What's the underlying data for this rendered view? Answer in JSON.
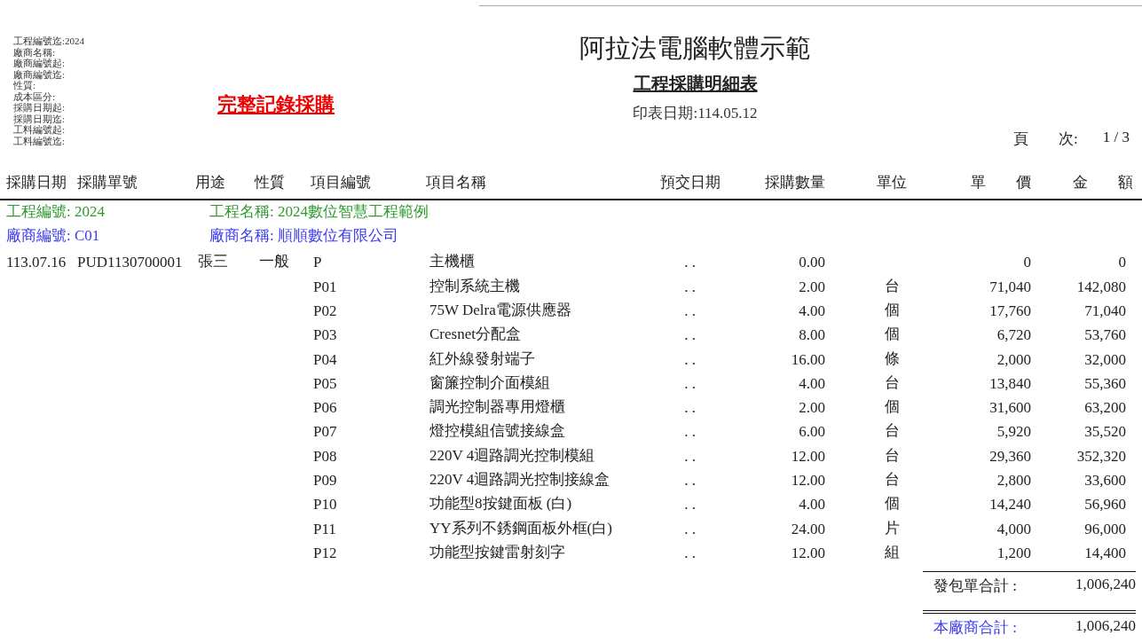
{
  "report": {
    "title": "阿拉法電腦軟體示範",
    "subtitle": "工程採購明細表",
    "print_date": "印表日期:114.05.12",
    "note": "完整記錄採購",
    "page_label": "頁　　次:",
    "page": "1 / 3"
  },
  "filters": [
    "工程編號迄:2024",
    "廠商名稱:",
    "廠商編號起:",
    "廠商編號迄:",
    "性質:",
    "成本區分:",
    "採購日期起:",
    "採購日期迄:",
    "工料編號起:",
    "工料編號迄:"
  ],
  "columns": [
    "採購日期",
    "採購單號",
    "用途",
    "性質",
    "項目編號",
    "項目名稱",
    "預交日期",
    "採購數量",
    "單位",
    "單　　價",
    "金　　額"
  ],
  "project": {
    "code": "工程編號: 2024",
    "name": "工程名稱: 2024數位智慧工程範例"
  },
  "vendor": {
    "code": "廠商編號: C01",
    "name": "廠商名稱: 順順數位有限公司"
  },
  "order": {
    "date": "113.07.16",
    "number": "PUD1130700001",
    "purpose": "張三",
    "nature": "一般"
  },
  "items": [
    {
      "code": "P",
      "name": "主機櫃",
      "delivery": ". .",
      "qty": "0.00",
      "price": "0",
      "amount": "0"
    },
    {
      "code": "P01",
      "name": "控制系統主機",
      "delivery": ". .",
      "qty": "2.00",
      "unit": "台",
      "price": "71,040",
      "amount": "142,080"
    },
    {
      "code": "P02",
      "name": "75W Delra電源供應器",
      "delivery": ". .",
      "qty": "4.00",
      "unit": "個",
      "price": "17,760",
      "amount": "71,040"
    },
    {
      "code": "P03",
      "name": "Cresnet分配盒",
      "delivery": ". .",
      "qty": "8.00",
      "unit": "個",
      "price": "6,720",
      "amount": "53,760"
    },
    {
      "code": "P04",
      "name": "紅外線發射端子",
      "delivery": ". .",
      "qty": "16.00",
      "unit": "條",
      "price": "2,000",
      "amount": "32,000"
    },
    {
      "code": "P05",
      "name": "窗簾控制介面模組",
      "delivery": ". .",
      "qty": "4.00",
      "unit": "台",
      "price": "13,840",
      "amount": "55,360"
    },
    {
      "code": "P06",
      "name": "調光控制器專用燈櫃",
      "delivery": ". .",
      "qty": "2.00",
      "unit": "個",
      "price": "31,600",
      "amount": "63,200"
    },
    {
      "code": "P07",
      "name": "燈控模組信號接線盒",
      "delivery": ". .",
      "qty": "6.00",
      "unit": "台",
      "price": "5,920",
      "amount": "35,520"
    },
    {
      "code": "P08",
      "name": "220V 4迴路調光控制模組",
      "delivery": ". .",
      "qty": "12.00",
      "unit": "台",
      "price": "29,360",
      "amount": "352,320"
    },
    {
      "code": "P09",
      "name": "220V 4迴路調光控制接線盒",
      "delivery": ". .",
      "qty": "12.00",
      "unit": "台",
      "price": "2,800",
      "amount": "33,600"
    },
    {
      "code": "P10",
      "name": "功能型8按鍵面板 (白)",
      "delivery": ". .",
      "qty": "4.00",
      "unit": "個",
      "price": "14,240",
      "amount": "56,960"
    },
    {
      "code": "P11",
      "name": "YY系列不銹鋼面板外框(白)",
      "delivery": ". .",
      "qty": "24.00",
      "unit": "片",
      "price": "4,000",
      "amount": "96,000"
    },
    {
      "code": "P12",
      "name": "功能型按鍵雷射刻字",
      "delivery": ". .",
      "qty": "12.00",
      "unit": "組",
      "price": "1,200",
      "amount": "14,400"
    }
  ],
  "totals": [
    {
      "kind": "order",
      "label": "發包單合計 :",
      "value": "1,006,240"
    },
    {
      "kind": "vendor",
      "label": "本廠商合計 :",
      "value": "1,006,240"
    }
  ]
}
